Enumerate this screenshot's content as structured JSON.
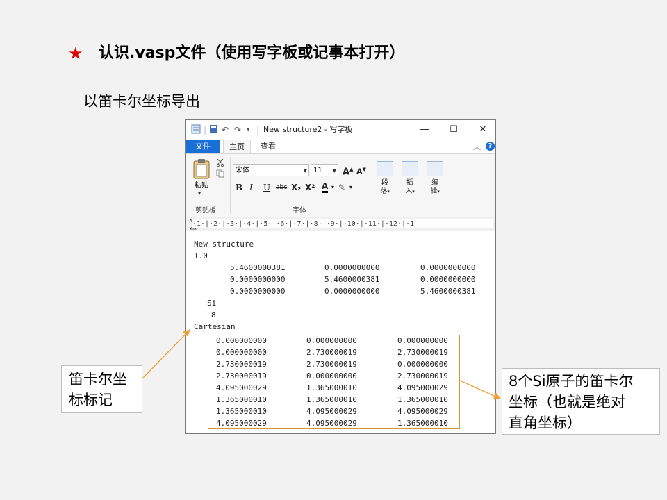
{
  "slide": {
    "title": "认识.vasp文件（使用写字板或记事本打开）",
    "subtitle": "以笛卡尔坐标导出",
    "star_color": "#e00000"
  },
  "window": {
    "title": "New structure2 - 写字板",
    "quick_access_icons": [
      "app-icon",
      "save-icon",
      "undo-icon",
      "redo-icon",
      "customize-icon"
    ],
    "controls": {
      "minimize": "—",
      "maximize": "☐",
      "close": "✕"
    },
    "tabs": {
      "file": "文件",
      "home": "主页",
      "view": "查看"
    },
    "accent_color": "#1a6fd6"
  },
  "ribbon": {
    "clipboard": {
      "paste_label": "粘贴",
      "group_label": "剪贴板"
    },
    "font": {
      "family": "宋体",
      "size": "11",
      "group_label": "字体",
      "buttons": {
        "bold": "B",
        "italic": "I",
        "underline": "U",
        "strike": "abc",
        "subscript": "X₂",
        "superscript": "X²",
        "color": "A"
      }
    },
    "paragraph": {
      "line1": "段",
      "line2": "落"
    },
    "insert": {
      "line1": "插",
      "line2": "入"
    },
    "edit": {
      "line1": "编",
      "line2": "辑"
    }
  },
  "ruler": {
    "scale": "·1·|·2·|·3·|·4·|·5·|·6·|·7·|·8·|·9·|·10·|·11·|·12·|·1"
  },
  "document": {
    "line1": "New structure",
    "line2": "1.0",
    "lattice": [
      [
        "5.4600000381",
        "0.0000000000",
        "0.0000000000"
      ],
      [
        "0.0000000000",
        "5.4600000381",
        "0.0000000000"
      ],
      [
        "0.0000000000",
        "0.0000000000",
        "5.4600000381"
      ]
    ],
    "element": "Si",
    "count": "8",
    "mode": "Cartesian",
    "coordinates": [
      [
        "0.000000000",
        "0.000000000",
        "0.000000000"
      ],
      [
        "0.000000000",
        "2.730000019",
        "2.730000019"
      ],
      [
        "2.730000019",
        "2.730000019",
        "0.000000000"
      ],
      [
        "2.730000019",
        "0.000000000",
        "2.730000019"
      ],
      [
        "4.095000029",
        "1.365000010",
        "4.095000029"
      ],
      [
        "1.365000010",
        "1.365000010",
        "1.365000010"
      ],
      [
        "1.365000010",
        "4.095000029",
        "4.095000029"
      ],
      [
        "4.095000029",
        "4.095000029",
        "1.365000010"
      ]
    ]
  },
  "callouts": {
    "left": {
      "line1": "笛卡尔坐",
      "line2": "标标记"
    },
    "right": {
      "line1": "8个Si原子的笛卡尔",
      "line2": "坐标（也就是绝对",
      "line3": "直角坐标）"
    },
    "arrow_color": "#f0a030"
  }
}
